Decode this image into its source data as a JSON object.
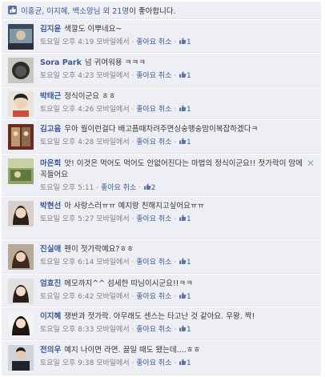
{
  "likes_summary": {
    "names": "이홍균, 이지혜, 백소망님 외 21명",
    "suffix": "이 좋아합니다."
  },
  "comments": [
    {
      "author": "김지윤",
      "text": "색깔도 이뿌네요~",
      "time": "토요일 오후 4:19 모바일에서",
      "like": "좋아요 취소",
      "count": "1"
    },
    {
      "author": "Sora Park",
      "text": "넘 귀여워용 ㅋㅋㅋ",
      "time": "토요일 오후 4:23 모바일에서",
      "like": "좋아요 취소",
      "count": "1"
    },
    {
      "author": "박태근",
      "text": "정식이군요 ㅎㅎ",
      "time": "토요일 오후 4:26 모바일에서",
      "like": "좋아요 취소",
      "count": "1"
    },
    {
      "author": "김고음",
      "text": "우아 월이런걸다 배고픔때차려주면싱숭맹숭맘이복잡하겠다ㅋ",
      "time": "토요일 오후 4:28 모바일에서",
      "like": "좋아요 취소",
      "count": "1"
    },
    {
      "author": "마은희",
      "text": "앗! 이것은 먹어도 먹어도 안없어진다는 마법의 정식이군요!! 젓가락이 맘에 꼭들어요",
      "time": "토요일 오후 5:11",
      "like": "좋아요 취소",
      "count": "2"
    },
    {
      "author": "박현선",
      "text": "아 사랑스러ㅠㅠ 예지랑 친해지고싶어요ㅠㅠ",
      "time": "토요일 오후 5:27 모바일에서",
      "like": "좋아요 취소",
      "count": "1"
    },
    {
      "author": "진실애",
      "text": "펜이 젓가락예요?ㅎㅎ",
      "time": "토요일 오후 6:14 모바일에서",
      "like": "좋아요 취소",
      "count": "1"
    },
    {
      "author": "엄효진",
      "text": "메모까지^^ 섬세한 따님이시군요!!ㅋㅋ",
      "time": "토요일 오후 6:42 모바일에서",
      "like": "좋아요 취소",
      "count": "1"
    },
    {
      "author": "이지혜",
      "text": "쟁반과 젓가락. 아무래도 센스는 타고난 것 같아요. 우왕. 짝!",
      "time": "토요일 오후 8:33 모바일에서",
      "like": "좋아요 취소",
      "count": "1"
    },
    {
      "author": "전의우",
      "text": "예지 나이면 라면. 끓일 때도 됐는데....ㅎㅎ",
      "time": "토요일 오후 9:38 모바일에서",
      "like": "좋아요 취소",
      "count": "1"
    }
  ]
}
